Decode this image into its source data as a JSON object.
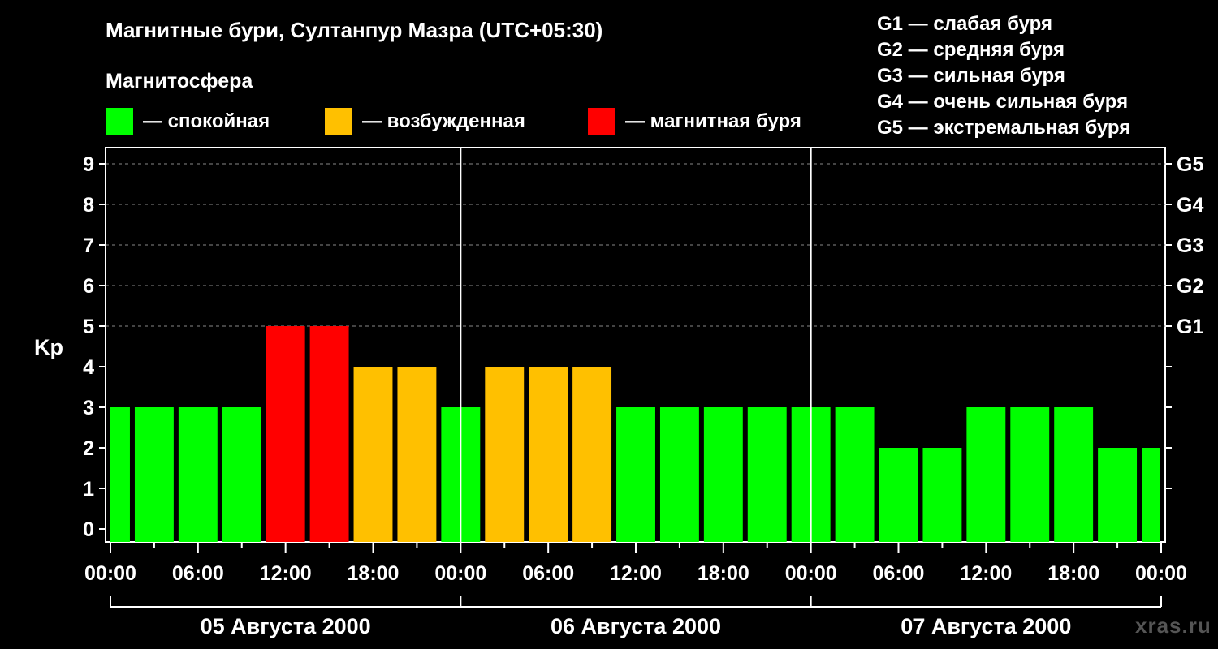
{
  "title": "Магнитные бури, Султанпур Мазра (UTC+05:30)",
  "subtitle": "Магнитосфера",
  "legend": [
    {
      "label": "— спокойная",
      "color": "#00ff00"
    },
    {
      "label": "— возбужденная",
      "color": "#ffc000"
    },
    {
      "label": "— магнитная буря",
      "color": "#ff0000"
    }
  ],
  "g_levels": [
    "G1 — слабая буря",
    "G2 — средняя буря",
    "G3 — сильная буря",
    "G4 — очень сильная буря",
    "G5 — экстремальная буря"
  ],
  "watermark": "xras.ru",
  "colors": {
    "quiet": "#00ff00",
    "active": "#ffc000",
    "storm": "#ff0000",
    "background": "#000000",
    "axis": "#ffffff",
    "grid": "#888888"
  },
  "chart_data": {
    "type": "bar",
    "ylabel": "Kp",
    "ylim": [
      0,
      9
    ],
    "yticks": [
      0,
      1,
      2,
      3,
      4,
      5,
      6,
      7,
      8,
      9
    ],
    "right_axis_labels": [
      {
        "kp": 5,
        "label": "G1"
      },
      {
        "kp": 6,
        "label": "G2"
      },
      {
        "kp": 7,
        "label": "G3"
      },
      {
        "kp": 8,
        "label": "G4"
      },
      {
        "kp": 9,
        "label": "G5"
      }
    ],
    "grid": "dashed horizontal at Kp 5–9",
    "xtick_labels": [
      "00:00",
      "06:00",
      "12:00",
      "18:00",
      "00:00",
      "06:00",
      "12:00",
      "18:00",
      "00:00",
      "06:00",
      "12:00",
      "18:00",
      "00:00"
    ],
    "day_labels": [
      "05 Августа 2000",
      "06 Августа 2000",
      "07 Августа 2000"
    ],
    "categories": [
      "05 Aug 00:00",
      "05 Aug 03:00",
      "05 Aug 06:00",
      "05 Aug 09:00",
      "05 Aug 12:00",
      "05 Aug 15:00",
      "05 Aug 18:00",
      "05 Aug 21:00",
      "06 Aug 00:00",
      "06 Aug 03:00",
      "06 Aug 06:00",
      "06 Aug 09:00",
      "06 Aug 12:00",
      "06 Aug 15:00",
      "06 Aug 18:00",
      "06 Aug 21:00",
      "07 Aug 00:00",
      "07 Aug 03:00",
      "07 Aug 06:00",
      "07 Aug 09:00",
      "07 Aug 12:00",
      "07 Aug 15:00",
      "07 Aug 18:00",
      "07 Aug 21:00"
    ],
    "start_hours": [
      -1.5,
      1.5,
      4.5,
      7.5,
      10.5,
      13.5,
      16.5,
      19.5,
      22.5,
      25.5,
      28.5,
      31.5,
      34.5,
      37.5,
      40.5,
      43.5,
      46.5,
      49.5,
      52.5,
      55.5,
      58.5,
      61.5,
      64.5,
      67.5,
      70.5
    ],
    "values": [
      3,
      3,
      3,
      3,
      5,
      5,
      4,
      4,
      3,
      4,
      4,
      4,
      3,
      3,
      3,
      3,
      3,
      3,
      2,
      2,
      3,
      3,
      3,
      2,
      2
    ]
  }
}
